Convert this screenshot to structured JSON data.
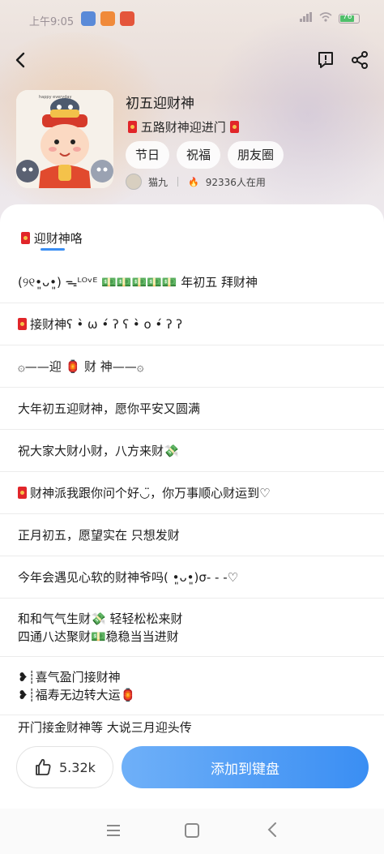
{
  "status_bar": {
    "time": "上午9:05",
    "battery": "76"
  },
  "pack": {
    "title": "初五迎财神",
    "subtitle": "五路财神迎进门",
    "tags": [
      "节日",
      "祝福",
      "朋友圈"
    ],
    "author": "猫九",
    "usage": "92336人在用",
    "cover_caption": "happy everyday"
  },
  "section": {
    "title": "迎财神咯"
  },
  "entries": [
    {
      "lines": [
        "(୨୧•͈ᴗ•͈) ᯓᴸᴼᵛᴱ 💵💵💵💵💵 年初五 拜财神"
      ],
      "lead": false,
      "height": 52
    },
    {
      "lines": [
        "接财神ʕ •̀ ω •́ ʔ ʕ •̀ o •́ ʔ ʔ"
      ],
      "lead": true,
      "height": 52
    },
    {
      "lines": [
        "۞——迎 🏮 财 神——۞"
      ],
      "lead": false,
      "height": 52
    },
    {
      "lines": [
        "大年初五迎财神，愿你平安又圆满"
      ],
      "lead": false,
      "height": 52
    },
    {
      "lines": [
        "祝大家大财小财，八方来财💸"
      ],
      "lead": false,
      "height": 52
    },
    {
      "lines": [
        "财神派我跟你问个好◡̈，你万事顺心财运到♡"
      ],
      "lead": true,
      "height": 52
    },
    {
      "lines": [
        "正月初五，愿望实在 只想发财"
      ],
      "lead": false,
      "height": 52
    },
    {
      "lines": [
        "今年会遇见心软的财神爷吗( •͈ᴗ•͈)σ- - -♡"
      ],
      "lead": false,
      "height": 52
    },
    {
      "lines": [
        "和和气气生财💸 轻轻松松来财",
        "四通八达聚财💵稳稳当当进财"
      ],
      "lead": false,
      "height": 72
    },
    {
      "lines": [
        "❥┊喜气盈门接财神",
        "❥┊福寿无边转大运🏮"
      ],
      "lead": false,
      "height": 72
    },
    {
      "lines": [
        "开门接金财神等 大说三月迎头传"
      ],
      "lead": false,
      "height": 30
    }
  ],
  "actions": {
    "like_count": "5.32k",
    "add_label": "添加到键盘"
  }
}
